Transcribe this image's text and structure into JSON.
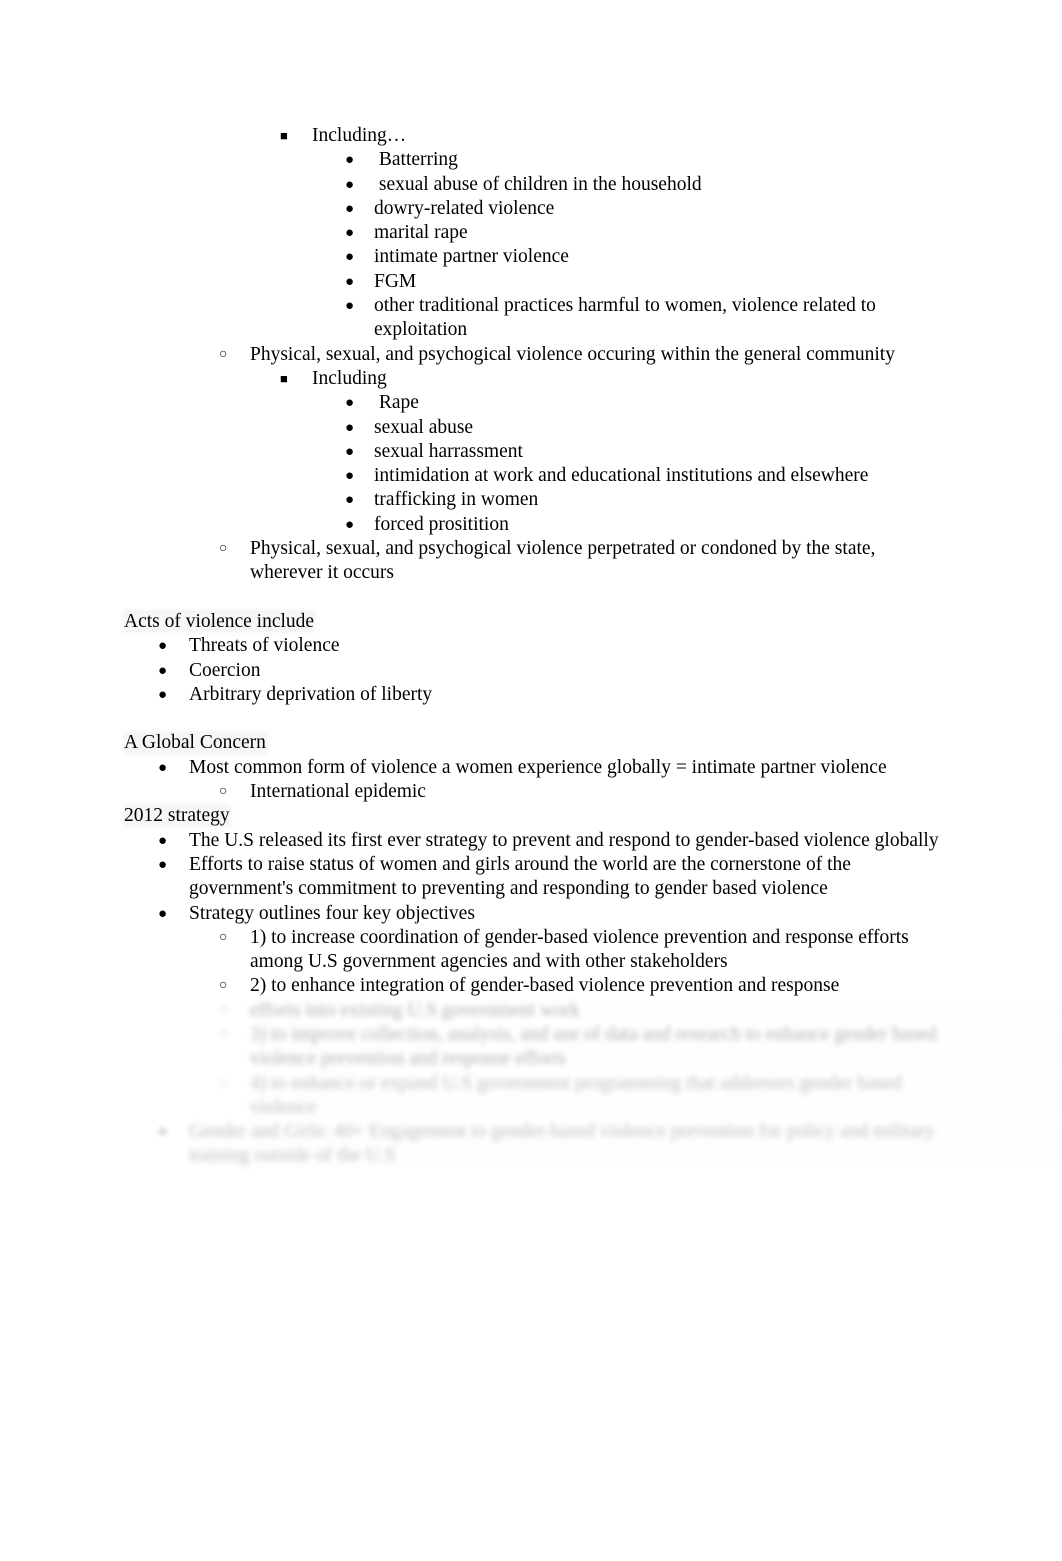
{
  "document": {
    "bullets": {
      "disc": "●",
      "circle": "○",
      "square": "■"
    },
    "blocks": [
      {
        "level": 3,
        "marker": "square",
        "text": "Including…"
      },
      {
        "level": 4,
        "marker": "disc",
        "text": " Batterring"
      },
      {
        "level": 4,
        "marker": "disc",
        "text": " sexual abuse of children in the household"
      },
      {
        "level": 4,
        "marker": "disc",
        "text": "dowry-related violence"
      },
      {
        "level": 4,
        "marker": "disc",
        "text": "marital rape"
      },
      {
        "level": 4,
        "marker": "disc",
        "text": "intimate partner violence"
      },
      {
        "level": 4,
        "marker": "disc",
        "text": "FGM"
      },
      {
        "level": 4,
        "marker": "disc",
        "text": "other traditional practices harmful to women, violence related to exploitation"
      },
      {
        "level": 2,
        "marker": "circle",
        "text": "Physical, sexual, and psychogical violence occuring within the general community"
      },
      {
        "level": 3,
        "marker": "square",
        "text": "Including"
      },
      {
        "level": 4,
        "marker": "disc",
        "text": " Rape"
      },
      {
        "level": 4,
        "marker": "disc",
        "text": "sexual abuse"
      },
      {
        "level": 4,
        "marker": "disc",
        "text": "sexual harrassment"
      },
      {
        "level": 4,
        "marker": "disc",
        "text": "intimidation at work and educational institutions and elsewhere"
      },
      {
        "level": 4,
        "marker": "disc",
        "text": "trafficking in women"
      },
      {
        "level": 4,
        "marker": "disc",
        "text": "forced prositition"
      },
      {
        "level": 2,
        "marker": "circle",
        "text": "Physical, sexual, and psychogical violence perpetrated or condoned by the state, wherever it occurs"
      },
      {
        "type": "spacer"
      },
      {
        "type": "heading",
        "text": "Acts of violence include"
      },
      {
        "level": 1,
        "marker": "disc",
        "text": "Threats of violence"
      },
      {
        "level": 1,
        "marker": "disc",
        "text": "Coercion"
      },
      {
        "level": 1,
        "marker": "disc",
        "text": "Arbitrary deprivation of liberty"
      },
      {
        "type": "spacer"
      },
      {
        "type": "heading",
        "text": "A Global Concern"
      },
      {
        "level": 1,
        "marker": "disc",
        "text": "Most common form of violence a women experience globally = intimate partner violence"
      },
      {
        "level": 2,
        "marker": "circle",
        "text": "International epidemic"
      },
      {
        "type": "heading",
        "text": "2012 strategy"
      },
      {
        "level": 1,
        "marker": "disc",
        "text": "The U.S released its first ever strategy to prevent and respond to gender-based violence globally"
      },
      {
        "level": 1,
        "marker": "disc",
        "text": "Efforts to raise status of women and girls around the world are the cornerstone of the government's commitment to preventing and responding to gender based violence"
      },
      {
        "level": 1,
        "marker": "disc",
        "text": "Strategy outlines four key objectives"
      },
      {
        "level": 2,
        "marker": "circle",
        "text": "1) to increase coordination of gender-based violence prevention and response efforts among U.S government agencies and with other stakeholders"
      },
      {
        "level": 2,
        "marker": "circle",
        "text": "2) to enhance integration of gender-based violence prevention and response"
      }
    ],
    "degraded_blocks": [
      {
        "level": 2,
        "marker": "circle",
        "text": "efforts into existing U.S government work",
        "fade": "faded"
      },
      {
        "level": 2,
        "marker": "circle",
        "text": "3) to improve collection, analysis, and use of data and research to enhance gender based violence prevention and response efforts",
        "fade": "faded"
      },
      {
        "level": 2,
        "marker": "circle",
        "text": "4) to enhance or expand U.S government programming that addresses gender based violence",
        "fade": "faded-more"
      },
      {
        "level": 1,
        "marker": "disc",
        "text": "Gender and Girls: 40+ Engagement to gender-based violence prevention for policy and military training outside of the U.S",
        "fade": "faded-more"
      }
    ]
  }
}
